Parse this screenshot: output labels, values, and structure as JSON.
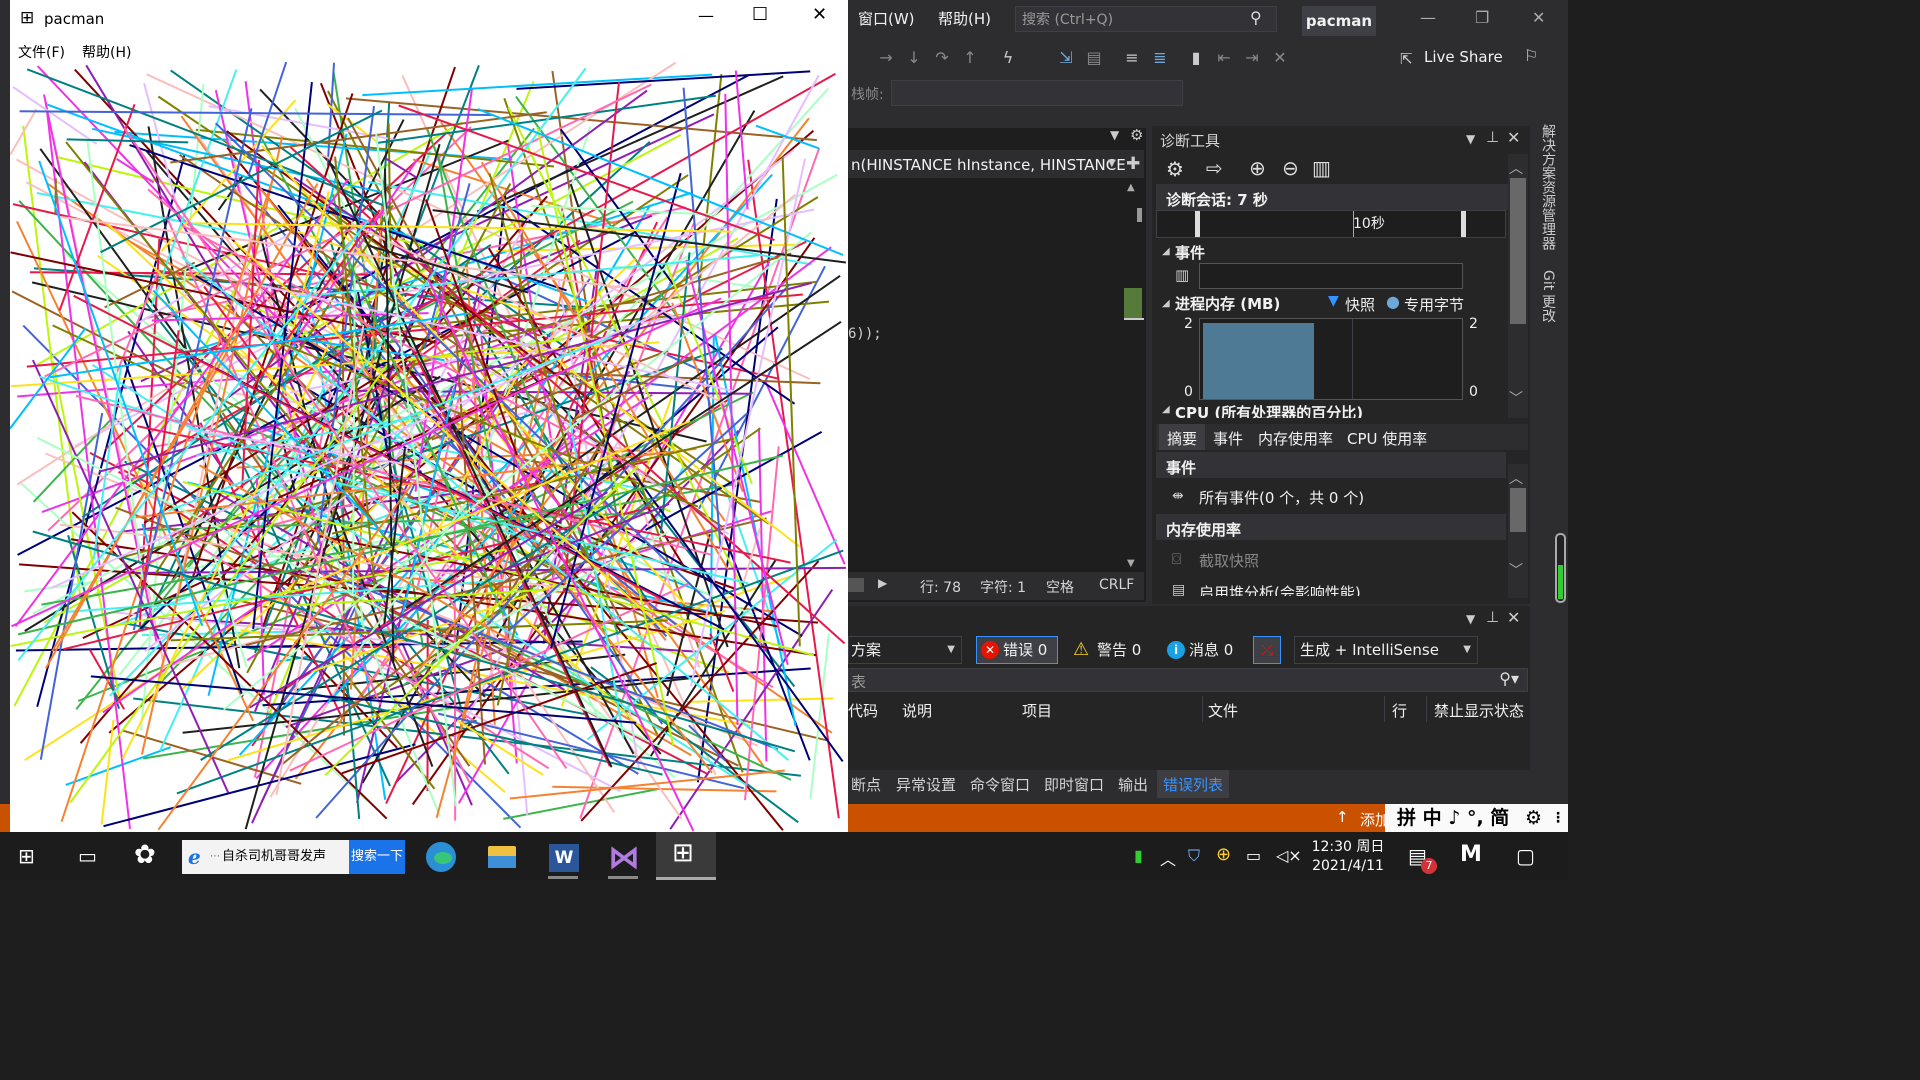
{
  "vs": {
    "menu": [
      "窗口(W)",
      "帮助(H)"
    ],
    "search_placeholder": "搜索 (Ctrl+Q)",
    "solution_title": "pacman",
    "live_share": "Live Share",
    "stack_frame_label": "栈帧:",
    "function_combo": "n(HINSTANCE hInstance, HINSTANCE",
    "code_fragment": "6));",
    "status": {
      "line": "行: 78",
      "char": "字符: 1",
      "spacing": "空格",
      "eol": "CRLF"
    },
    "side_tabs": [
      "解决方案资源管理器",
      "Git 更改"
    ]
  },
  "diag": {
    "title": "诊断工具",
    "session": "诊断会话: 7 秒",
    "timeline_label": "10秒",
    "events_header": "事件",
    "memory_header": "进程内存 (MB)",
    "legend_snapshot": "快照",
    "legend_private": "专用字节",
    "y_max": "2",
    "y_min": "0",
    "cpu_header": "CPU (所有处理器的百分比)",
    "tabs": [
      "摘要",
      "事件",
      "内存使用率",
      "CPU 使用率"
    ],
    "events_section": "事件",
    "all_events": "所有事件(0 个，共 0 个)",
    "memory_section": "内存使用率",
    "take_snapshot": "截取快照",
    "heap_analysis": "启用堆分析(会影响性能)"
  },
  "errors": {
    "scope": "方案",
    "errors_btn": "错误 0",
    "warnings_btn": "警告 0",
    "messages_btn": "消息 0",
    "build_filter": "生成 + IntelliSense",
    "search_label": "表",
    "columns": [
      "代码",
      "说明",
      "项目",
      "文件",
      "行",
      "禁止显示状态"
    ]
  },
  "bottom_tabs": [
    "断点",
    "异常设置",
    "命令窗口",
    "即时窗口",
    "输出",
    "错误列表"
  ],
  "status_bar_right": "添加",
  "ime_glyphs": "拼 中 ♪ °, 简",
  "pacman": {
    "title": "pacman",
    "menu": [
      "文件(F)",
      "帮助(H)"
    ]
  },
  "taskbar": {
    "search_text": "自杀司机哥哥发声",
    "search_button": "搜索一下",
    "time": "12:30 周日",
    "date": "2021/4/11",
    "notification_badge": "7"
  },
  "colors": {
    "vs_bg": "#2d2d30",
    "accent": "#ca5100",
    "blue": "#3794ff",
    "mem_bar": "#4f7a96"
  }
}
